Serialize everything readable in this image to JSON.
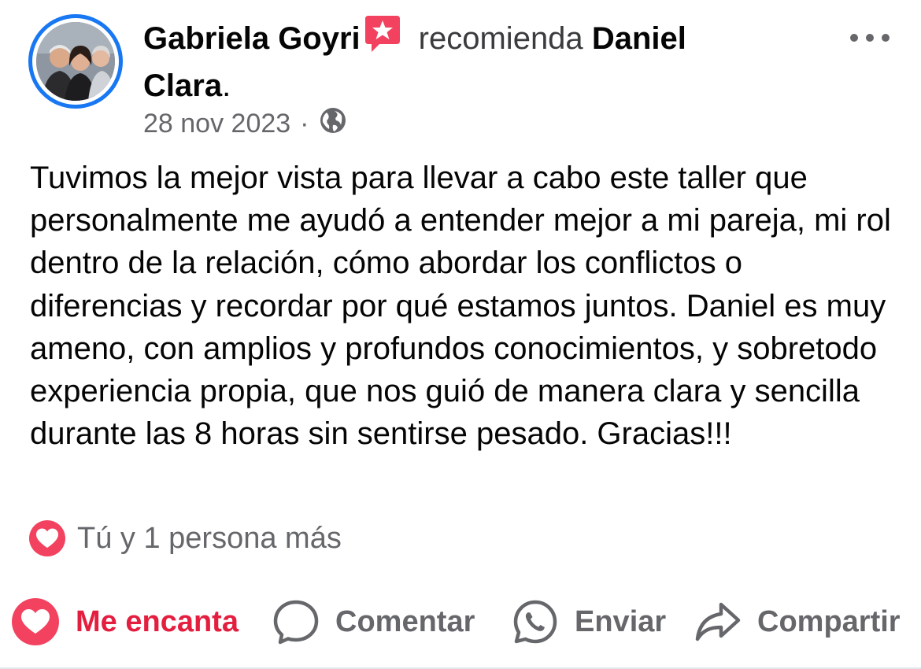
{
  "post": {
    "author_name": "Gabriela Goyri",
    "recommend_word": "recomienda",
    "target_name_first": "Daniel",
    "target_name_second": "Clara",
    "target_suffix": ".",
    "date": "28 nov 2023",
    "separator": "·",
    "privacy_icon": "globe-icon",
    "text": "Tuvimos la mejor vista para llevar a cabo este taller que personalmente me ayudó a entender mejor a mi pareja, mi rol dentro de la relación, cómo abordar los conflictos o diferencias y recordar por qué estamos juntos. Daniel es muy ameno, con amplios y profundos conocimientos, y sobretodo experiencia propia, que nos guió de manera clara y sencilla durante las 8 horas sin sentirse pesado. Gracias!!!"
  },
  "reactions": {
    "icon": "heart-reaction-icon",
    "summary": "Tú y 1 persona más"
  },
  "actions": {
    "love_label": "Me encanta",
    "comment_label": "Comentar",
    "send_label": "Enviar",
    "share_label": "Compartir"
  },
  "colors": {
    "accent_blue": "#1877f2",
    "love_red": "#e41e3f",
    "secondary_text": "#65676b",
    "badge_pink": "#f3425f"
  }
}
